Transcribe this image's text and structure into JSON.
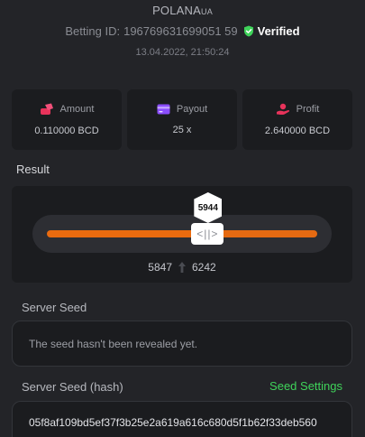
{
  "header": {
    "username": "POLANA",
    "username_suffix": "UA",
    "bet_id_label": "Betting ID:",
    "bet_id_value": "196769631699051 59",
    "verified_label": "Verified",
    "datetime": "13.04.2022, 21:50:24"
  },
  "stats": [
    {
      "label": "Amount",
      "value": "0.110000 BCD",
      "icon": "coins-icon"
    },
    {
      "label": "Payout",
      "value": "25 x",
      "icon": "card-icon"
    },
    {
      "label": "Profit",
      "value": "2.640000 BCD",
      "icon": "hand-coin-icon"
    }
  ],
  "result": {
    "label": "Result",
    "value": "5944",
    "range_low": "5847",
    "range_high": "6242",
    "pointer_fraction": 0.5944,
    "handle_glyph": "<||>"
  },
  "server_seed": {
    "label": "Server Seed",
    "text": "The seed hasn't been revealed yet."
  },
  "server_seed_hash": {
    "label": "Server Seed (hash)",
    "settings_link": "Seed Settings",
    "value": "05f8af109bd5ef37f3b25e2a619a616c680d5f1b62f33deb560"
  },
  "colors": {
    "background": "#232428",
    "panel": "#1b1c1f",
    "accent_orange": "#ea6b0f",
    "verified_green": "#3fd35a",
    "link_green": "#3fd35a"
  }
}
